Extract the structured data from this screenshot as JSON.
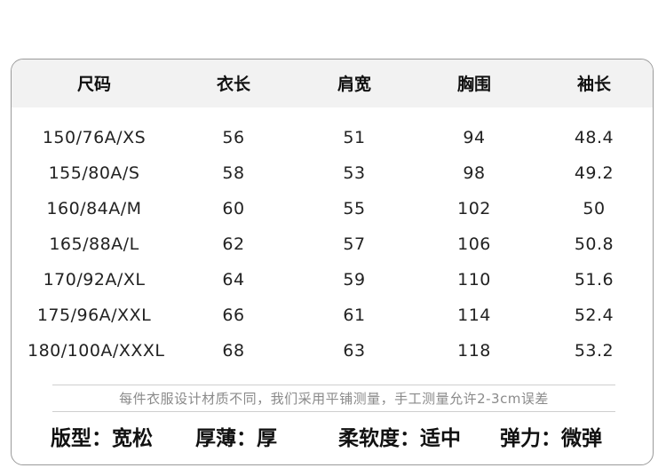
{
  "table": {
    "headers": [
      "尺码",
      "衣长",
      "肩宽",
      "胸围",
      "袖长"
    ],
    "rows": [
      [
        "150/76A/XS",
        "56",
        "51",
        "94",
        "48.4"
      ],
      [
        "155/80A/S",
        "58",
        "53",
        "98",
        "49.2"
      ],
      [
        "160/84A/M",
        "60",
        "55",
        "102",
        "50"
      ],
      [
        "165/88A/L",
        "62",
        "57",
        "106",
        "50.8"
      ],
      [
        "170/92A/XL",
        "64",
        "59",
        "110",
        "51.6"
      ],
      [
        "175/96A/XXL",
        "66",
        "61",
        "114",
        "52.4"
      ],
      [
        "180/100A/XXXL",
        "68",
        "63",
        "118",
        "53.2"
      ]
    ]
  },
  "note": "每件衣服设计材质不同，我们采用平铺测量，手工测量允许2-3cm误差",
  "properties": {
    "fit": "版型：宽松",
    "thickness": "厚薄：厚",
    "softness": "柔软度：适中",
    "elasticity": "弹力：微弹"
  }
}
